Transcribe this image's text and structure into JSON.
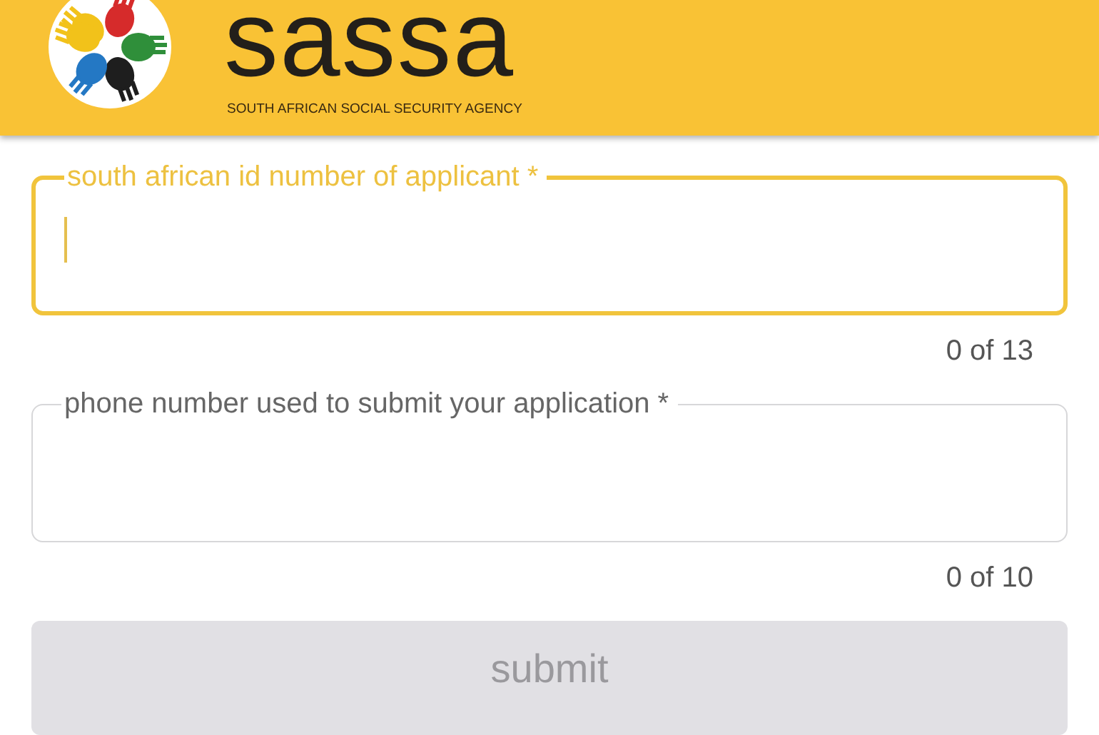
{
  "header": {
    "title": "sassa",
    "subtitle": "SOUTH AFRICAN SOCIAL SECURITY AGENCY"
  },
  "fields": [
    {
      "label": "south african id number of applicant *",
      "focused": true,
      "counter": "0 of 13"
    },
    {
      "label": "phone number used to submit your application *",
      "focused": false,
      "counter": "0 of 10"
    }
  ],
  "submit": {
    "label": "submit",
    "disabled": true
  }
}
